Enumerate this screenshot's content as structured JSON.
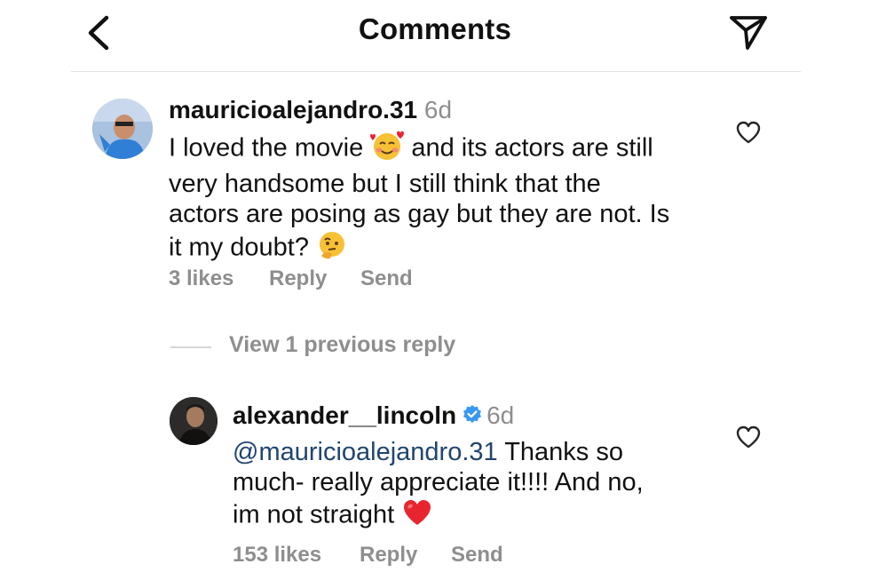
{
  "header": {
    "title": "Comments"
  },
  "comments": [
    {
      "username": "mauricioalejandro.31",
      "time": "6d",
      "lines": [
        "I loved the movie",
        "and its actors are still",
        "very handsome but I still think that the",
        "actors are posing as gay but they are not. Is",
        "it my doubt?"
      ],
      "emoji_after_line1": "smiling-face-with-hearts",
      "emoji_end": "thinking-face",
      "likes": "3 likes",
      "reply": "Reply",
      "send": "Send"
    }
  ],
  "view_previous": "View 1 previous reply",
  "reply": {
    "username": "alexander__lincoln",
    "verified": true,
    "time": "6d",
    "mention": "@mauricioalejandro.31",
    "line1_rest": " Thanks so",
    "line2": "much- really appreciate it!!!! And no,",
    "line3": "im not straight",
    "emoji_end": "red-heart",
    "likes": "153 likes",
    "reply": "Reply",
    "send": "Send"
  },
  "colors": {
    "meta": "#8e8e8e",
    "mention": "#20456f",
    "verified": "#3897f0",
    "heart": "#e8252f"
  }
}
